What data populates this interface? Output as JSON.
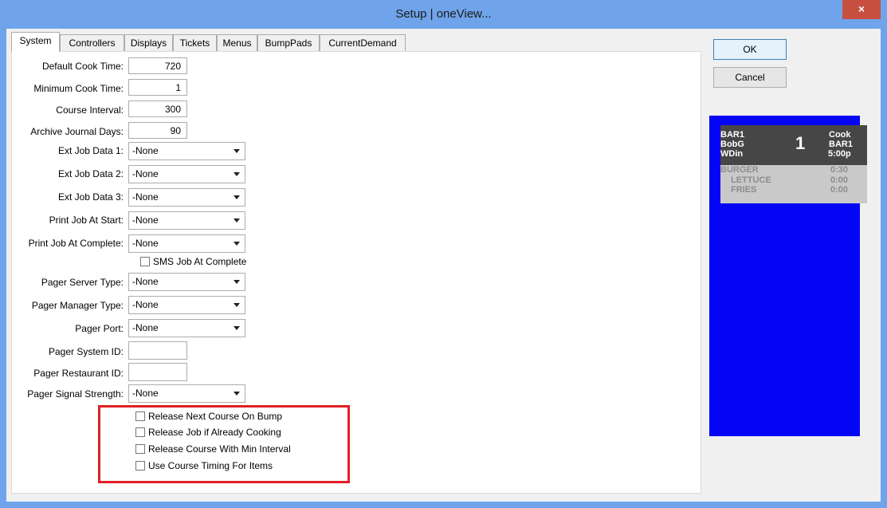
{
  "window": {
    "title": "Setup | oneView...",
    "close_glyph": "×"
  },
  "tabs": [
    "System",
    "Controllers",
    "Displays",
    "Tickets",
    "Menus",
    "BumpPads",
    "CurrentDemand"
  ],
  "buttons": {
    "ok": "OK",
    "cancel": "Cancel"
  },
  "fields": {
    "default_cook_time": {
      "label": "Default Cook Time:",
      "value": "720"
    },
    "minimum_cook_time": {
      "label": "Minimum Cook Time:",
      "value": "1"
    },
    "course_interval": {
      "label": "Course Interval:",
      "value": "300"
    },
    "archive_journal_days": {
      "label": "Archive Journal Days:",
      "value": "90"
    },
    "ext_job_data_1": {
      "label": "Ext Job Data 1:",
      "value": "-None"
    },
    "ext_job_data_2": {
      "label": "Ext Job Data 2:",
      "value": "-None"
    },
    "ext_job_data_3": {
      "label": "Ext Job Data 3:",
      "value": "-None"
    },
    "print_job_at_start": {
      "label": "Print Job At Start:",
      "value": "-None"
    },
    "print_job_at_complete": {
      "label": "Print Job At Complete:",
      "value": "-None"
    },
    "sms_job_at_complete": {
      "label": "SMS Job At Complete",
      "checked": false
    },
    "pager_server_type": {
      "label": "Pager Server Type:",
      "value": "-None"
    },
    "pager_manager_type": {
      "label": "Pager Manager Type:",
      "value": "-None"
    },
    "pager_port": {
      "label": "Pager Port:",
      "value": "-None"
    },
    "pager_system_id": {
      "label": "Pager System ID:",
      "value": ""
    },
    "pager_restaurant_id": {
      "label": "Pager Restaurant ID:",
      "value": ""
    },
    "pager_signal_strength": {
      "label": "Pager Signal Strength:",
      "value": "-None"
    }
  },
  "course_options": [
    {
      "label": "Release Next Course On Bump",
      "checked": false
    },
    {
      "label": "Release Job if Already Cooking",
      "checked": false
    },
    {
      "label": "Release Course With Min Interval",
      "checked": false
    },
    {
      "label": "Use Course Timing For Items",
      "checked": false
    }
  ],
  "preview": {
    "background_color": "#0505f5",
    "header": {
      "left": [
        "BAR1",
        "BobG",
        "WDin"
      ],
      "number": "1",
      "right": [
        "Cook",
        "BAR1",
        "5:00p"
      ]
    },
    "items": [
      {
        "name": "BURGER",
        "time": "0:30"
      },
      {
        "name": "LETTUCE",
        "time": "0:00"
      },
      {
        "name": "FRIES",
        "time": "0:00"
      }
    ]
  }
}
